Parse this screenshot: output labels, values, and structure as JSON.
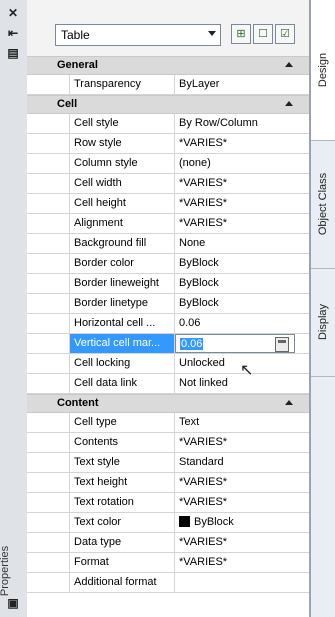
{
  "leftstrip": {
    "close_icon": "close-icon",
    "autohide_icon": "autohide-icon",
    "properties_icon": "properties-icon",
    "label": "Properties"
  },
  "toolbar": {
    "combo_value": "Table",
    "btn1": "quick-select-icon",
    "btn2": "select-objects-icon",
    "btn3": "toggle-pickadd-icon"
  },
  "sections": [
    {
      "title": "General",
      "rows": [
        {
          "name": "Transparency",
          "value": "ByLayer"
        }
      ]
    },
    {
      "title": "Cell",
      "rows": [
        {
          "name": "Cell style",
          "value": "By Row/Column"
        },
        {
          "name": "Row style",
          "value": "*VARIES*"
        },
        {
          "name": "Column style",
          "value": "(none)"
        },
        {
          "name": "Cell width",
          "value": "*VARIES*"
        },
        {
          "name": "Cell height",
          "value": "*VARIES*"
        },
        {
          "name": "Alignment",
          "value": "*VARIES*"
        },
        {
          "name": "Background fill",
          "value": "None"
        },
        {
          "name": "Border color",
          "value": "ByBlock"
        },
        {
          "name": "Border lineweight",
          "value": "ByBlock"
        },
        {
          "name": "Border linetype",
          "value": "ByBlock"
        },
        {
          "name": "Horizontal cell ...",
          "value": "0.06"
        },
        {
          "name": "Vertical cell mar...",
          "value": "0.06"
        },
        {
          "name": "Cell locking",
          "value": "Unlocked"
        },
        {
          "name": "Cell data link",
          "value": "Not linked"
        }
      ]
    },
    {
      "title": "Content",
      "rows": [
        {
          "name": "Cell type",
          "value": "Text"
        },
        {
          "name": "Contents",
          "value": "*VARIES*"
        },
        {
          "name": "Text style",
          "value": "Standard"
        },
        {
          "name": "Text height",
          "value": "*VARIES*"
        },
        {
          "name": "Text rotation",
          "value": "*VARIES*"
        },
        {
          "name": "Text color",
          "value": "ByBlock"
        },
        {
          "name": "Data type",
          "value": "*VARIES*"
        },
        {
          "name": "Format",
          "value": "*VARIES*"
        },
        {
          "name": "Additional format",
          "value": ""
        }
      ]
    }
  ],
  "tabs": [
    "Design",
    "Object Class",
    "Display"
  ]
}
